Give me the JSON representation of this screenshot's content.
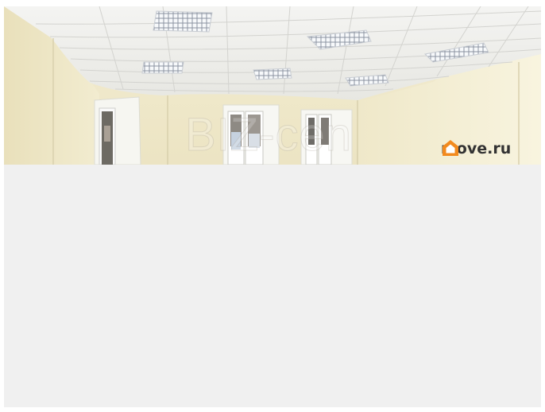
{
  "photo": {
    "watermark_text": "BIZ-cen",
    "brand_text": "move.ru",
    "brand_icon": "house-icon",
    "colors": {
      "brand_accent": "#f28a1e",
      "brand_text": "#333333",
      "empty_area": "#f0f0f0"
    }
  }
}
